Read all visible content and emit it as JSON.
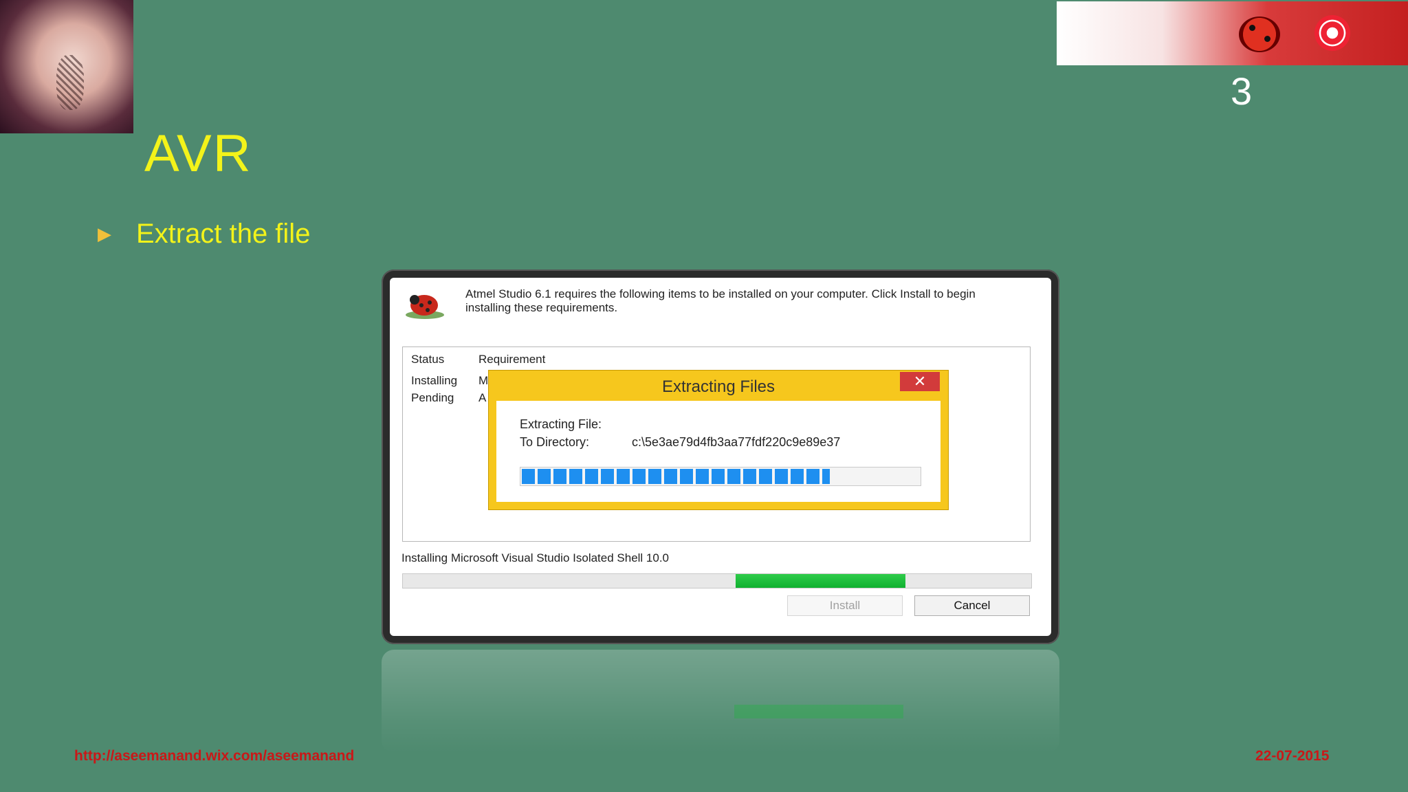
{
  "slide": {
    "number": "3",
    "title": "AVR",
    "bullet": "Extract the file",
    "footer_url": "http://aseemanand.wix.com/aseemanand",
    "footer_date": "22-07-2015"
  },
  "installer": {
    "header": "Atmel Studio 6.1 requires the following items to be installed on your computer. Click Install to begin installing these requirements.",
    "columns": [
      "Status",
      "Requirement"
    ],
    "rows": [
      {
        "status": "Installing",
        "requirement": "M"
      },
      {
        "status": "Pending",
        "requirement": "A"
      }
    ],
    "progress_caption": "Installing Microsoft Visual Studio Isolated Shell 10.0",
    "progress_range": [
      0.53,
      0.8
    ],
    "buttons": {
      "install": "Install",
      "cancel": "Cancel"
    }
  },
  "extract": {
    "title": "Extracting Files",
    "close_glyph": "✕",
    "file_label": "Extracting File:",
    "dir_label": "To Directory:",
    "dir_value": "c:\\5e3ae79d4fb3aa77fdf220c9e89e37",
    "progress": 0.77
  },
  "colors": {
    "background": "#4e8a6f",
    "title": "#f3f31a",
    "footer": "#c91818",
    "extract_frame": "#f6c71d",
    "progress_blue": "#1e8ff0",
    "progress_green": "#10b030"
  }
}
